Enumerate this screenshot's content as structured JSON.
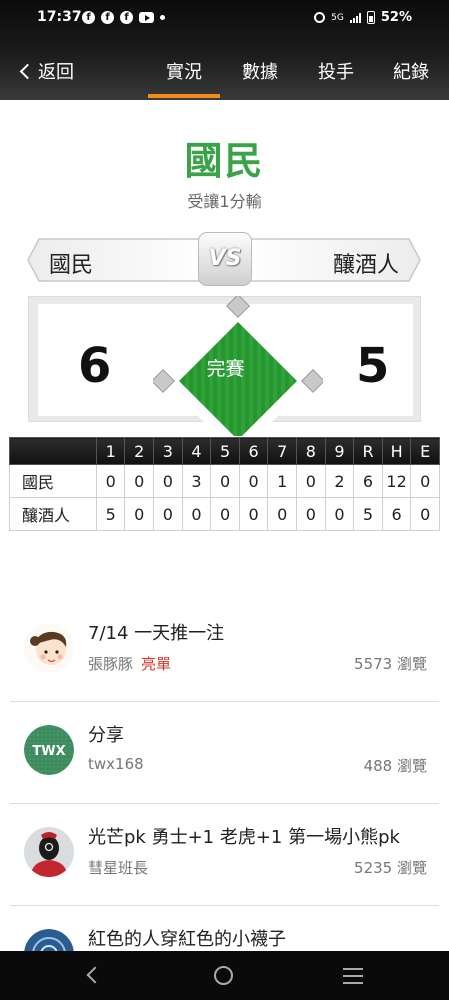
{
  "status_bar": {
    "time": "17:37",
    "network": "5G",
    "battery": "52%"
  },
  "header": {
    "back_label": "返回",
    "tabs": [
      {
        "label": "實況",
        "active": true
      },
      {
        "label": "數據",
        "active": false
      },
      {
        "label": "投手",
        "active": false
      },
      {
        "label": "紀錄",
        "active": false
      }
    ]
  },
  "result": {
    "winner": "國民",
    "handicap_text": "受讓1分輸",
    "vs_label": "VS",
    "away_team": "國民",
    "home_team": "釀酒人",
    "away_score": "6",
    "home_score": "5",
    "game_status": "完賽"
  },
  "line_score": {
    "headers": [
      "1",
      "2",
      "3",
      "4",
      "5",
      "6",
      "7",
      "8",
      "9",
      "R",
      "H",
      "E"
    ],
    "rows": [
      {
        "team": "國民",
        "values": [
          "0",
          "0",
          "0",
          "3",
          "0",
          "0",
          "1",
          "0",
          "2",
          "6",
          "12",
          "0"
        ]
      },
      {
        "team": "釀酒人",
        "values": [
          "5",
          "0",
          "0",
          "0",
          "0",
          "0",
          "0",
          "0",
          "0",
          "5",
          "6",
          "0"
        ]
      }
    ]
  },
  "articles": [
    {
      "title": "7/14 一天推一注",
      "author": "張豚豚",
      "tag": "亮單",
      "views": "5573 瀏覽",
      "avatar_icon": "cartoon-girl-icon"
    },
    {
      "title": "分享",
      "author": "twx168",
      "tag": "",
      "views": "488 瀏覽",
      "avatar_icon": "twx-logo-icon",
      "avatar_text": "TWX"
    },
    {
      "title": "光芒pk 勇士+1 老虎+1 第一場小熊pk",
      "author": "彗星班長",
      "tag": "",
      "views": "5235 瀏覽",
      "avatar_icon": "masked-figure-icon"
    },
    {
      "title": "紅色的人穿紅色的小襪子",
      "author": "",
      "tag": "",
      "views": "",
      "avatar_icon": "blue-pattern-icon"
    }
  ],
  "colors": {
    "accent": "#f28a1d",
    "winner_green": "#3aa247",
    "hot_tag": "#d9342b"
  }
}
